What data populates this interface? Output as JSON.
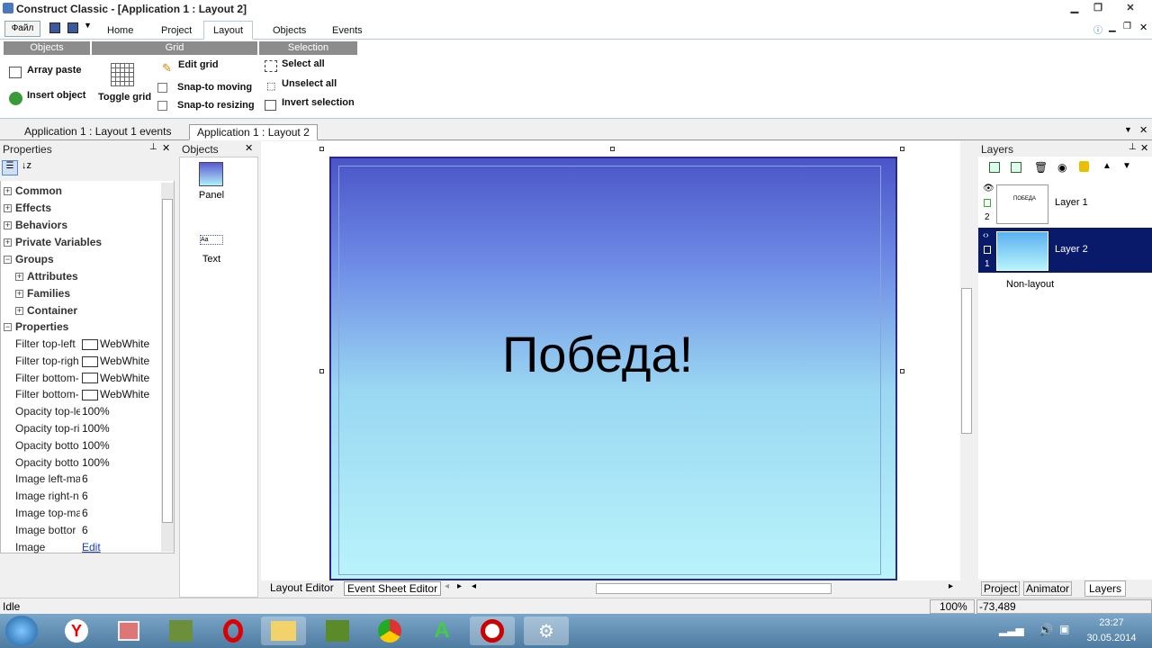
{
  "window": {
    "title": "Construct Classic - [Application 1 : Layout 2]"
  },
  "ribbon": {
    "file_label": "Файл",
    "tabs": [
      "Home",
      "Project",
      "Layout",
      "Objects",
      "Events"
    ],
    "groups": {
      "objects": "Objects",
      "grid": "Grid",
      "selection": "Selection"
    },
    "array_paste": "Array paste",
    "insert_object": "Insert object",
    "toggle_grid": "Toggle grid",
    "edit_grid": "Edit grid",
    "snap_moving": "Snap-to moving",
    "snap_resizing": "Snap-to resizing",
    "select_all": "Select all",
    "unselect_all": "Unselect all",
    "invert_selection": "Invert selection"
  },
  "doc_tabs": [
    "Application 1 : Layout 1 events",
    "Application 1 : Layout 2"
  ],
  "properties": {
    "title": "Properties",
    "groups": [
      "Common",
      "Effects",
      "Behaviors",
      "Private Variables",
      "Groups"
    ],
    "subgroups": [
      "Attributes",
      "Families",
      "Container"
    ],
    "section": "Properties",
    "rows": [
      {
        "label": "Filter top-left",
        "value": "WebWhite",
        "swatch": true
      },
      {
        "label": "Filter top-righ",
        "value": "WebWhite",
        "swatch": true
      },
      {
        "label": "Filter bottom-",
        "value": "WebWhite",
        "swatch": true
      },
      {
        "label": "Filter bottom-",
        "value": "WebWhite",
        "swatch": true
      },
      {
        "label": "Opacity top-le",
        "value": "100%"
      },
      {
        "label": "Opacity top-ri",
        "value": "100%"
      },
      {
        "label": "Opacity botto",
        "value": "100%"
      },
      {
        "label": "Opacity botto",
        "value": "100%"
      },
      {
        "label": "Image left-ma",
        "value": "6"
      },
      {
        "label": "Image right-n",
        "value": "6"
      },
      {
        "label": "Image top-ma",
        "value": "6"
      },
      {
        "label": "Image bottor",
        "value": "6"
      },
      {
        "label": "Image",
        "value": "Edit",
        "link": true
      }
    ]
  },
  "objects": {
    "title": "Objects",
    "items": [
      "Panel",
      "Text"
    ]
  },
  "canvas": {
    "text": "Победа!"
  },
  "bottom_tabs": [
    "Layout Editor",
    "Event Sheet Editor"
  ],
  "layers": {
    "title": "Layers",
    "items": [
      {
        "name": "Layer 1",
        "index": "2"
      },
      {
        "name": "Layer 2",
        "index": "1"
      }
    ],
    "nonlayout": "Non-layout",
    "tabs": [
      "Project",
      "Animator",
      "Layers"
    ]
  },
  "status": {
    "state": "Idle",
    "zoom": "100%",
    "coords": "-73,489"
  },
  "taskbar": {
    "time": "23:27",
    "date": "30.05.2014"
  },
  "colors": {
    "layer_selected": "#0a1a6a",
    "layout_border": "#2b2a8a"
  }
}
